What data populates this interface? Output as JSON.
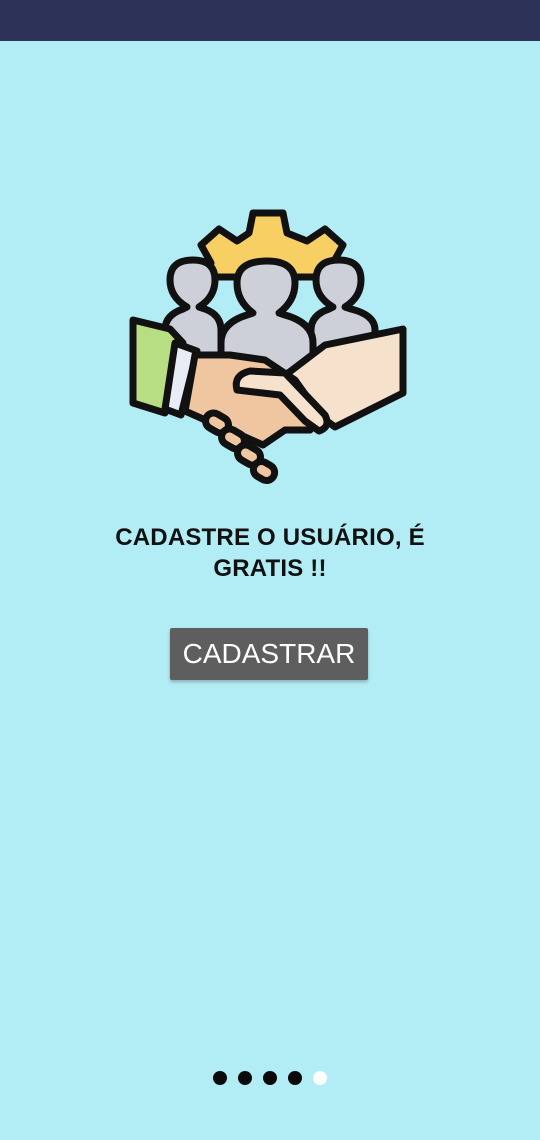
{
  "colors": {
    "background": "#b2ecf4",
    "status_bar": "#2c3258",
    "button_bg": "#5e5e5e",
    "button_text": "#ffffff",
    "dot_inactive": "#0a0a0a",
    "dot_active": "#ffffff"
  },
  "illustration": {
    "icon": "handshake-team-gear-icon"
  },
  "onboarding": {
    "headline_line1": "CADASTRE O USUÁRIO, É",
    "headline_line2": "GRATIS !!",
    "cta_label": "CADASTRAR"
  },
  "pager": {
    "total_pages": 5,
    "current_page": 5
  }
}
